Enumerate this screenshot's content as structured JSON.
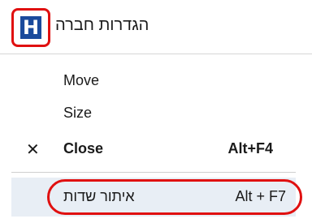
{
  "titlebar": {
    "icon_letter": "H",
    "title": "הגדרות חברה",
    "brand_color": "#1a4a9c",
    "highlight_color": "#e01010"
  },
  "menu": {
    "items": [
      {
        "label": "Move",
        "shortcut": "",
        "mark": ""
      },
      {
        "label": "Size",
        "shortcut": "",
        "mark": ""
      },
      {
        "label": "Close",
        "shortcut": "Alt+F4",
        "mark": "✕"
      },
      {
        "label": "איתור שדות",
        "shortcut": "Alt + F7",
        "mark": ""
      }
    ]
  }
}
